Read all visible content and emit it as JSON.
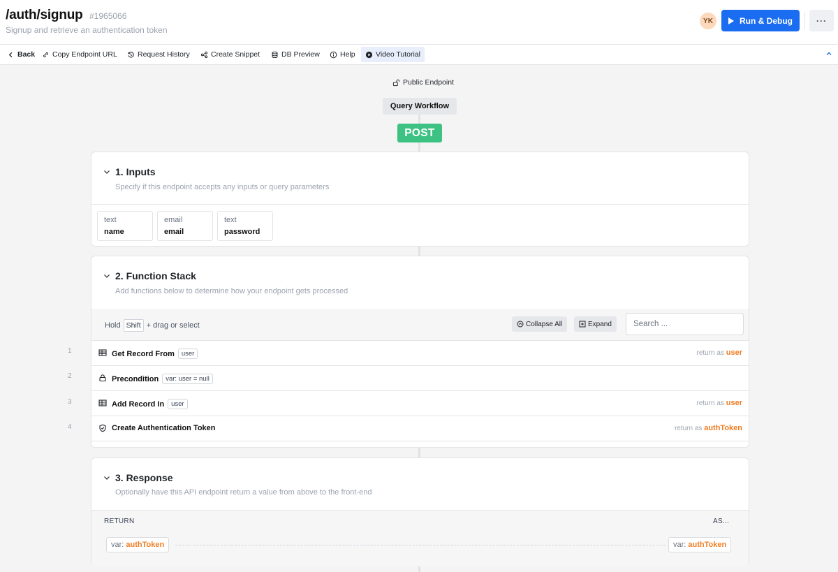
{
  "header": {
    "title": "/auth/signup",
    "endpoint_id": "#1965066",
    "subtitle": "Signup and retrieve an authentication token",
    "avatar_initials": "YK",
    "run_label": "Run & Debug",
    "more_label": "···",
    "accent_color": "#1a6cf0"
  },
  "toolbar": {
    "back": "Back",
    "copy_url": "Copy Endpoint URL",
    "request_history": "Request History",
    "create_snippet": "Create Snippet",
    "db_preview": "DB Preview",
    "help": "Help",
    "video_tutorial": "Video Tutorial"
  },
  "workflow": {
    "public_endpoint": "Public Endpoint",
    "query_workflow": "Query Workflow",
    "method": "POST",
    "method_color": "#3ec283"
  },
  "inputs": {
    "title": "1. Inputs",
    "description": "Specify if this endpoint accepts any inputs or query parameters",
    "fields": [
      {
        "type": "text",
        "name": "name"
      },
      {
        "type": "email",
        "name": "email"
      },
      {
        "type": "text",
        "name": "password"
      }
    ]
  },
  "function_stack": {
    "title": "2. Function Stack",
    "description": "Add functions below to determine how your endpoint gets processed",
    "hold": "Hold",
    "shift_key": "Shift",
    "drag_hint": "+ drag or select",
    "collapse_all": "Collapse All",
    "expand": "Expand",
    "search_placeholder": "Search ...",
    "return_as": "return as",
    "rows": [
      {
        "num": "1",
        "label": "Get Record From",
        "tag": "user",
        "return_var": "user",
        "icon": "table-icon"
      },
      {
        "num": "2",
        "label": "Precondition",
        "tag": "var: user  =  null",
        "return_var": "",
        "icon": "lock-icon"
      },
      {
        "num": "3",
        "label": "Add Record In",
        "tag": "user",
        "return_var": "user",
        "icon": "table-icon"
      },
      {
        "num": "4",
        "label": "Create Authentication Token",
        "tag": "",
        "return_var": "authToken",
        "icon": "shield-icon"
      }
    ]
  },
  "response": {
    "title": "3. Response",
    "description": "Optionally have this API endpoint return a value from above to the front-end",
    "return_label": "RETURN",
    "as_label": "AS...",
    "var_prefix": "var:",
    "return_value": "authToken",
    "as_value": "authToken",
    "highlight_color": "#ef7d23"
  }
}
